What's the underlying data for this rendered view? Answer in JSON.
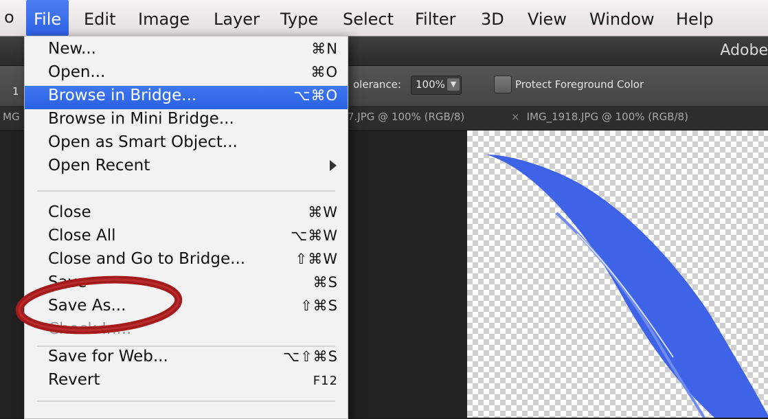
{
  "menubar": {
    "apple_fragment": "o",
    "items": [
      "File",
      "Edit",
      "Image",
      "Layer",
      "Type",
      "Select",
      "Filter",
      "3D",
      "View",
      "Window",
      "Help"
    ]
  },
  "app": {
    "title": "Adobe"
  },
  "options": {
    "tolerance_label": "olerance:",
    "tolerance_value": "100%",
    "protect_label": "Protect Foreground Color",
    "left_fragment": "1"
  },
  "tabs": {
    "left_fragment": "MG",
    "tab1": "7.JPG @ 100% (RGB/8)",
    "tab2_close": "×",
    "tab2": "IMG_1918.JPG @ 100% (RGB/8)"
  },
  "file_menu": {
    "items": [
      {
        "label": "New...",
        "shortcut": "⌘N"
      },
      {
        "label": "Open...",
        "shortcut": "⌘O"
      },
      {
        "label": "Browse in Bridge...",
        "shortcut": "⌥⌘O"
      },
      {
        "label": "Browse in Mini Bridge...",
        "shortcut": ""
      },
      {
        "label": "Open as Smart Object...",
        "shortcut": ""
      },
      {
        "label": "Open Recent",
        "shortcut": ""
      },
      {
        "label": "Close",
        "shortcut": "⌘W"
      },
      {
        "label": "Close All",
        "shortcut": "⌥⌘W"
      },
      {
        "label": "Close and Go to Bridge...",
        "shortcut": "⇧⌘W"
      },
      {
        "label": "Save",
        "shortcut": "⌘S"
      },
      {
        "label": "Save As...",
        "shortcut": "⇧⌘S"
      },
      {
        "label": "Check In...",
        "shortcut": ""
      },
      {
        "label": "Save for Web...",
        "shortcut": "⌥⇧⌘S"
      },
      {
        "label": "Revert",
        "shortcut": "F12"
      }
    ]
  },
  "colors": {
    "highlight": "#2f62e6",
    "annotation": "#a51b1b",
    "feather": "#3f63e6"
  }
}
